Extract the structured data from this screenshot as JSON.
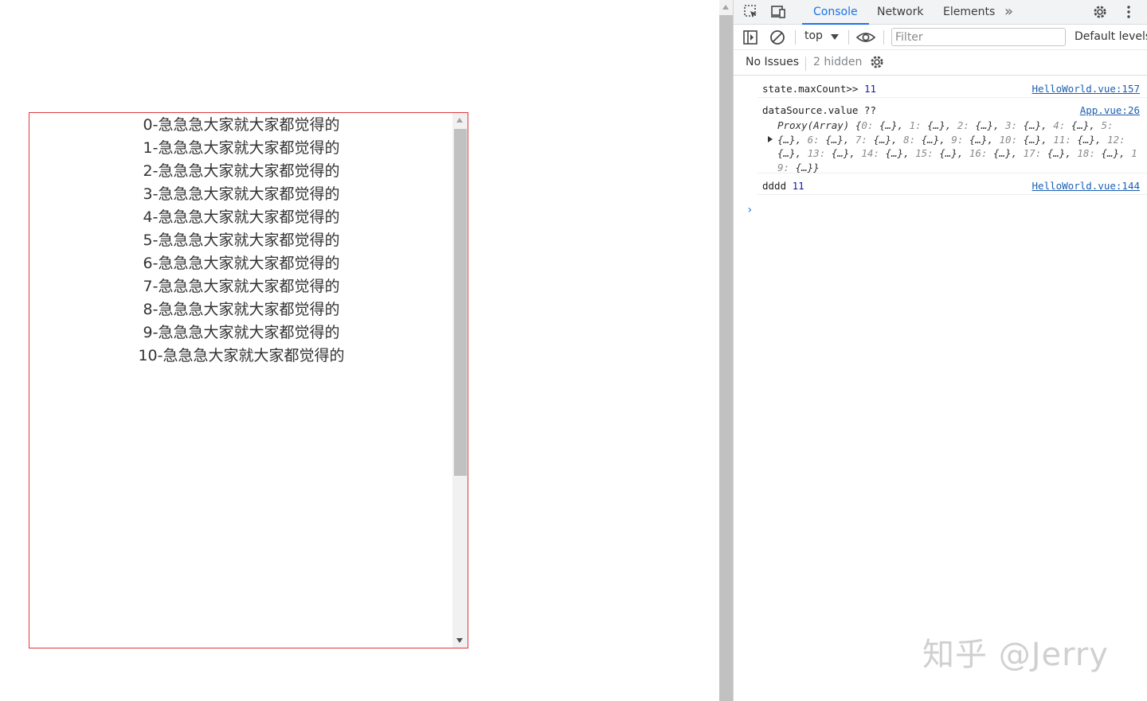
{
  "list": {
    "items": [
      "0-急急急大家就大家都觉得的",
      "1-急急急大家就大家都觉得的",
      "2-急急急大家就大家都觉得的",
      "3-急急急大家就大家都觉得的",
      "4-急急急大家就大家都觉得的",
      "5-急急急大家就大家都觉得的",
      "6-急急急大家就大家都觉得的",
      "7-急急急大家就大家都觉得的",
      "8-急急急大家就大家都觉得的",
      "9-急急急大家就大家都觉得的",
      "10-急急急大家就大家都觉得的"
    ],
    "border_color": "#e0393e"
  },
  "devtools": {
    "tabs": {
      "console": "Console",
      "network": "Network",
      "elements": "Elements",
      "more": "»"
    },
    "toolbar": {
      "context": "top",
      "filter_placeholder": "Filter",
      "levels": "Default levels ▾"
    },
    "issues": {
      "no_issues": "No Issues",
      "hidden": "2 hidden"
    },
    "logs": [
      {
        "message": "state.maxCount>>",
        "value": "11",
        "source": "HelloWorld.vue:157"
      },
      {
        "message": "dataSource.value ??",
        "source": "App.vue:26"
      },
      {
        "message": "dddd",
        "value": "11",
        "source": "HelloWorld.vue:144"
      }
    ],
    "proxy": {
      "label": "Proxy(Array)",
      "entries": [
        {
          "k": "0",
          "v": "{…}"
        },
        {
          "k": "1",
          "v": "{…}"
        },
        {
          "k": "2",
          "v": "{…}"
        },
        {
          "k": "3",
          "v": "{…}"
        },
        {
          "k": "4",
          "v": "{…}"
        },
        {
          "k": "5",
          "v": "{…}"
        },
        {
          "k": "6",
          "v": "{…}"
        },
        {
          "k": "7",
          "v": "{…}"
        },
        {
          "k": "8",
          "v": "{…}"
        },
        {
          "k": "9",
          "v": "{…}"
        },
        {
          "k": "10",
          "v": "{…}"
        },
        {
          "k": "11",
          "v": "{…}"
        },
        {
          "k": "12",
          "v": "{…}"
        },
        {
          "k": "13",
          "v": "{…}"
        },
        {
          "k": "14",
          "v": "{…}"
        },
        {
          "k": "15",
          "v": "{…}"
        },
        {
          "k": "16",
          "v": "{…}"
        },
        {
          "k": "17",
          "v": "{…}"
        },
        {
          "k": "18",
          "v": "{…}"
        },
        {
          "k": "19",
          "v": "{…}"
        }
      ]
    },
    "prompt": "›",
    "accent_color": "#1a73e8"
  },
  "watermark": "知乎 @Jerry"
}
